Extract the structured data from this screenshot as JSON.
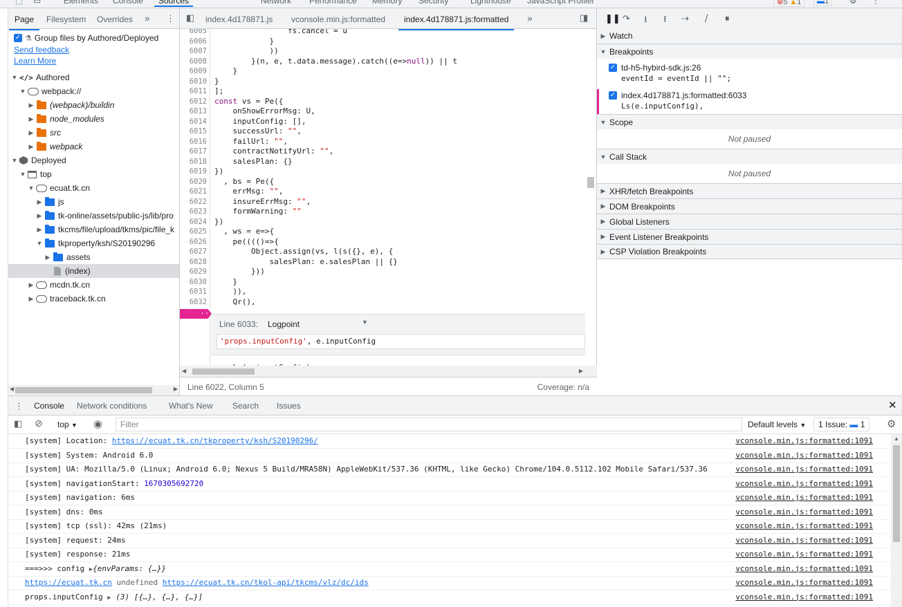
{
  "main_tabs": [
    "Elements",
    "Console",
    "Sources",
    "Network",
    "Performance",
    "Memory",
    "Security",
    "Lighthouse",
    "JavaScript Profiler"
  ],
  "main_tabs_active": "Sources",
  "badges": {
    "errors": "5",
    "warnings": "1",
    "info": "1"
  },
  "navigator": {
    "tabs": [
      "Page",
      "Filesystem",
      "Overrides"
    ],
    "more": "»",
    "group_label": "Group files by Authored/Deployed",
    "send_feedback": "Send feedback",
    "learn_more": "Learn More",
    "tree": [
      {
        "label": "Authored",
        "icon": "code-icon",
        "arrow": "▼",
        "depth": 0
      },
      {
        "label": "webpack://",
        "icon": "cloud-icon",
        "arrow": "▼",
        "depth": 1
      },
      {
        "label": "(webpack)/buildin",
        "icon": "folder-orange-icon",
        "arrow": "▶",
        "depth": 2,
        "italic": true
      },
      {
        "label": "node_modules",
        "icon": "folder-orange-icon",
        "arrow": "▶",
        "depth": 2,
        "italic": true
      },
      {
        "label": "src",
        "icon": "folder-orange-icon",
        "arrow": "▶",
        "depth": 2,
        "italic": true
      },
      {
        "label": "webpack",
        "icon": "folder-orange-icon",
        "arrow": "▶",
        "depth": 2,
        "italic": true
      },
      {
        "label": "Deployed",
        "icon": "box-icon",
        "arrow": "▼",
        "depth": 0
      },
      {
        "label": "top",
        "icon": "frame-icon",
        "arrow": "▼",
        "depth": 1
      },
      {
        "label": "ecuat.tk.cn",
        "icon": "cloud-icon",
        "arrow": "▼",
        "depth": 2
      },
      {
        "label": "js",
        "icon": "folder-blue-icon",
        "arrow": "▶",
        "depth": 3
      },
      {
        "label": "tk-online/assets/public-js/lib/pro",
        "icon": "folder-blue-icon",
        "arrow": "▶",
        "depth": 3
      },
      {
        "label": "tkcms/file/upload/tkms/pic/file_k",
        "icon": "folder-blue-icon",
        "arrow": "▶",
        "depth": 3
      },
      {
        "label": "tkproperty/ksh/S20190296",
        "icon": "folder-blue-icon",
        "arrow": "▼",
        "depth": 3
      },
      {
        "label": "assets",
        "icon": "folder-blue-icon",
        "arrow": "▶",
        "depth": 4
      },
      {
        "label": "(index)",
        "icon": "file-icon",
        "arrow": "",
        "depth": 4,
        "selected": true
      },
      {
        "label": "mcdn.tk.cn",
        "icon": "cloud-icon",
        "arrow": "▶",
        "depth": 2
      },
      {
        "label": "traceback.tk.cn",
        "icon": "cloud-icon",
        "arrow": "▶",
        "depth": 2
      }
    ]
  },
  "editor": {
    "tabs": [
      "index.4d178871.js",
      "vconsole.min.js:formatted",
      "index.4d178871.js:formatted"
    ],
    "active_tab": "index.4d178871.js:formatted",
    "more": "»",
    "lines": [
      {
        "n": "6005",
        "code": "                fs.cancel = u"
      },
      {
        "n": "6006",
        "code": "            }"
      },
      {
        "n": "6007",
        "code": "            ))"
      },
      {
        "n": "6008",
        "code": "        }(n, e, t.data.message).catch((e=>null)) || t"
      },
      {
        "n": "6009",
        "code": "    }"
      },
      {
        "n": "6010",
        "code": "}"
      },
      {
        "n": "6011",
        "code": "];"
      },
      {
        "n": "6012",
        "code": "const vs = Pe({"
      },
      {
        "n": "6013",
        "code": "    onShowErrorMsg: U,"
      },
      {
        "n": "6014",
        "code": "    inputConfig: [],"
      },
      {
        "n": "6015",
        "code": "    successUrl: \"\","
      },
      {
        "n": "6016",
        "code": "    failUrl: \"\","
      },
      {
        "n": "6017",
        "code": "    contractNotifyUrl: \"\","
      },
      {
        "n": "6018",
        "code": "    salesPlan: {}"
      },
      {
        "n": "6019",
        "code": "})"
      },
      {
        "n": "6020",
        "code": "  , bs = Pe({"
      },
      {
        "n": "6021",
        "code": "    errMsg: \"\","
      },
      {
        "n": "6022",
        "code": "    insureErrMsg: \"\","
      },
      {
        "n": "6023",
        "code": "    formWarning: \"\""
      },
      {
        "n": "6024",
        "code": "})"
      },
      {
        "n": "6025",
        "code": "  , ws = e=>{"
      },
      {
        "n": "6026",
        "code": "    pe(((()=>{"
      },
      {
        "n": "6027",
        "code": "        Object.assign(vs, l(s({}, e), {"
      },
      {
        "n": "6028",
        "code": "            salesPlan: e.salesPlan || {}"
      },
      {
        "n": "6029",
        "code": "        }))"
      },
      {
        "n": "6030",
        "code": "    }"
      },
      {
        "n": "6031",
        "code": "    )),"
      },
      {
        "n": "6032",
        "code": "    Qr(),"
      }
    ],
    "breakpoint_line": "6033",
    "breakpoint_dots": "··",
    "logpoint": {
      "line_label": "Line 6033:",
      "type": "Logpoint",
      "expression": "'props.inputConfig', e.inputConfig"
    },
    "after_line": "    Ls(e.inputConfig),",
    "status_left": "Line 6022, Column 5",
    "status_right": "Coverage: n/a"
  },
  "debugger": {
    "sections": {
      "watch": "Watch",
      "breakpoints": "Breakpoints",
      "scope": "Scope",
      "call_stack": "Call Stack",
      "xhr": "XHR/fetch Breakpoints",
      "dom": "DOM Breakpoints",
      "global": "Global Listeners",
      "event": "Event Listener Breakpoints",
      "csp": "CSP Violation Breakpoints"
    },
    "breakpoints": [
      {
        "file": "td-h5-hybird-sdk.js:26",
        "code": "eventId = eventId || \"\";"
      },
      {
        "file": "index.4d178871.js:formatted:6033",
        "code": "Ls(e.inputConfig),"
      }
    ],
    "not_paused": "Not paused"
  },
  "drawer": {
    "tabs": [
      "Console",
      "Network conditions",
      "What's New",
      "Search",
      "Issues"
    ],
    "active": "Console",
    "context": "top",
    "filter_placeholder": "Filter",
    "levels": "Default levels",
    "issues": "1 Issue:",
    "issues_count": "1",
    "messages": [
      {
        "pre": "[system] Location: ",
        "link": "https://ecuat.tk.cn/tkproperty/ksh/S20190296/",
        "src": "vconsole.min.js:formatted:1091"
      },
      {
        "pre": "[system] System: Android 6.0",
        "src": "vconsole.min.js:formatted:1091"
      },
      {
        "pre": "[system] UA: Mozilla/5.0 (Linux; Android 6.0; Nexus 5 Build/MRA58N) AppleWebKit/537.36 (KHTML, like Gecko) Chrome/104.0.5112.102 Mobile Safari/537.36",
        "src": "vconsole.min.js:formatted:1091"
      },
      {
        "pre": "[system] navigationStart: ",
        "num": "1670305692720",
        "src": "vconsole.min.js:formatted:1091"
      },
      {
        "pre": "[system] navigation: 6ms",
        "src": "vconsole.min.js:formatted:1091"
      },
      {
        "pre": "[system] dns: 0ms",
        "src": "vconsole.min.js:formatted:1091"
      },
      {
        "pre": "[system] tcp (ssl): 42ms (21ms)",
        "src": "vconsole.min.js:formatted:1091"
      },
      {
        "pre": "[system] request: 24ms",
        "src": "vconsole.min.js:formatted:1091"
      },
      {
        "pre": "[system] response: 21ms",
        "src": "vconsole.min.js:formatted:1091"
      },
      {
        "pre": "===>>> config ",
        "obj": "{envParams: {…}}",
        "src": "vconsole.min.js:formatted:1091"
      },
      {
        "link1": "https://ecuat.tk.cn",
        "grey": " undefined ",
        "link2": "https://ecuat.tk.cn/tkol-api/tkcms/vlz/dc/ids",
        "src": "vconsole.min.js:formatted:1091"
      },
      {
        "pre": "props.inputConfig ",
        "objnum": "(3)",
        "obj": " [{…}, {…}, {…}]",
        "src": "vconsole.min.js:formatted:1091"
      }
    ]
  }
}
